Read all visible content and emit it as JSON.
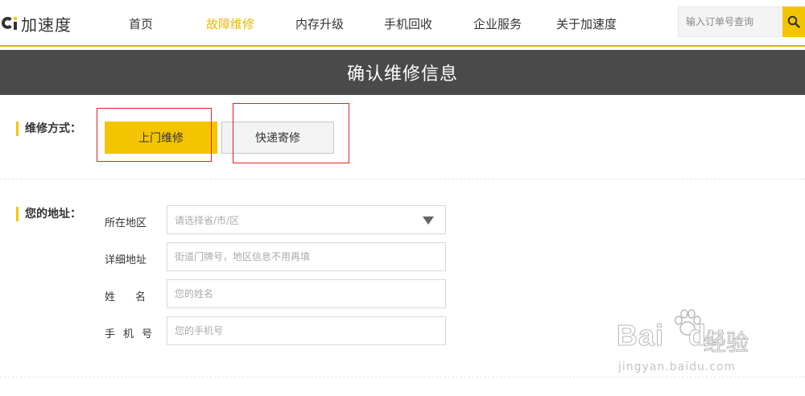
{
  "header": {
    "logo_text": "加速度",
    "nav": [
      {
        "label": "首页",
        "active": false
      },
      {
        "label": "故障维修",
        "active": true
      },
      {
        "label": "内存升级",
        "active": false
      },
      {
        "label": "手机回收",
        "active": false
      },
      {
        "label": "企业服务",
        "active": false
      },
      {
        "label": "关于加速度",
        "active": false
      }
    ],
    "search": {
      "placeholder": "输入订单号查询",
      "icon": "search-icon"
    }
  },
  "page_title": "确认维修信息",
  "repair_method": {
    "label": "维修方式：",
    "options": [
      {
        "label": "上门维修",
        "selected": true
      },
      {
        "label": "快递寄修",
        "selected": false
      }
    ]
  },
  "address": {
    "label": "您的地址：",
    "fields": [
      {
        "label": "所在地区",
        "placeholder": "请选择省/市/区",
        "type": "select"
      },
      {
        "label": "详细地址",
        "placeholder": "街道门牌号，地区信息不用再填",
        "type": "text"
      },
      {
        "label": "姓　名",
        "placeholder": "您的姓名",
        "type": "text"
      },
      {
        "label": "手机号",
        "placeholder": "您的手机号",
        "type": "text"
      }
    ]
  },
  "watermark": {
    "brand": "Bai",
    "brand2": "du",
    "jingyan": "经验",
    "url": "jingyan.baidu.com"
  },
  "colors": {
    "accent": "#f5c400",
    "title_bar": "#4a4a4a",
    "highlight_box": "#e0202a"
  }
}
